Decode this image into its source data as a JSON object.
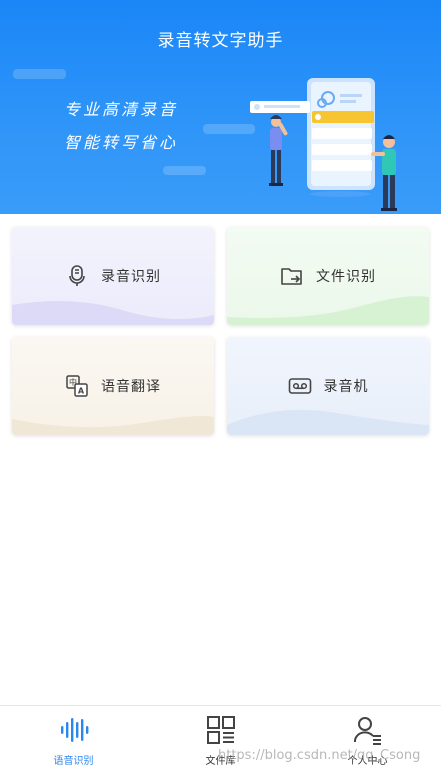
{
  "header": {
    "title": "录音转文字助手",
    "slogan_line1": "专业高清录音",
    "slogan_line2": "智能转写省心",
    "bg_color": "#1a86f7"
  },
  "cards": [
    {
      "label": "录音识别",
      "icon": "microphone-icon"
    },
    {
      "label": "文件识别",
      "icon": "folder-import-icon"
    },
    {
      "label": "语音翻译",
      "icon": "translate-icon"
    },
    {
      "label": "录音机",
      "icon": "cassette-icon"
    }
  ],
  "tabbar": {
    "active_color": "#2b86f0",
    "tabs": [
      {
        "label": "语音识别",
        "icon": "sound-wave-icon",
        "active": true
      },
      {
        "label": "文件库",
        "icon": "grid-list-icon",
        "active": false
      },
      {
        "label": "个人中心",
        "icon": "user-profile-icon",
        "active": false
      }
    ]
  },
  "watermark": "https://blog.csdn.net/qq_Csong"
}
